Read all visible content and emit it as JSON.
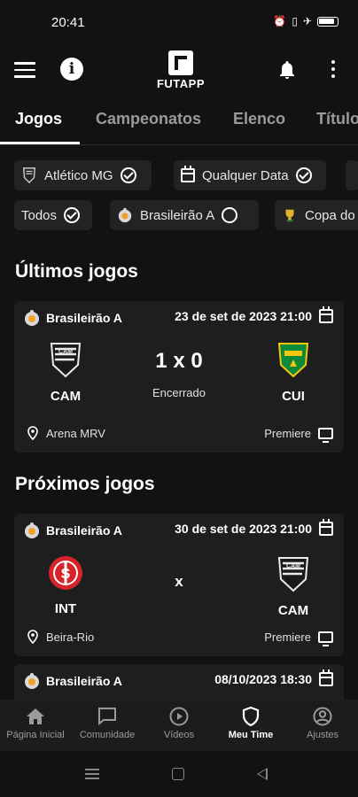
{
  "status_bar": {
    "time": "20:41"
  },
  "app": {
    "logo_text": "FUTAPP"
  },
  "tabs": [
    {
      "label": "Jogos",
      "active": true
    },
    {
      "label": "Campeonatos",
      "active": false
    },
    {
      "label": "Elenco",
      "active": false
    },
    {
      "label": "Títulos",
      "active": false
    }
  ],
  "filters": {
    "row1": [
      {
        "label": "Atlético MG",
        "icon": "team-crest-icon",
        "checked": true
      },
      {
        "label": "Qualquer Data",
        "icon": "calendar-icon",
        "checked": true
      }
    ],
    "row2": [
      {
        "label": "Todos",
        "checked": true
      },
      {
        "label": "Brasileirão A",
        "icon": "competition-icon",
        "checked": false
      },
      {
        "label": "Copa do Brasil",
        "icon": "cup-icon"
      }
    ]
  },
  "sections": {
    "last_games_title": "Últimos jogos",
    "next_games_title": "Próximos jogos"
  },
  "last_games": [
    {
      "competition": "Brasileirão A",
      "datetime": "23 de set de 2023 21:00",
      "home": "CAM",
      "away": "CUI",
      "score": "1 x 0",
      "status": "Encerrado",
      "venue": "Arena MRV",
      "broadcaster": "Premiere"
    }
  ],
  "next_games": [
    {
      "competition": "Brasileirão A",
      "datetime": "30 de set de 2023 21:00",
      "home": "INT",
      "away": "CAM",
      "versus": "x",
      "venue": "Beira-Rio",
      "broadcaster": "Premiere"
    },
    {
      "competition": "Brasileirão A",
      "datetime": "08/10/2023 18:30"
    }
  ],
  "bottom_nav": [
    {
      "label": "Página Inicial",
      "icon": "home-icon",
      "active": false
    },
    {
      "label": "Comunidade",
      "icon": "chat-icon",
      "active": false
    },
    {
      "label": "Vídeos",
      "icon": "play-icon",
      "active": false
    },
    {
      "label": "Meu Time",
      "icon": "shield-icon",
      "active": true
    },
    {
      "label": "Ajustes",
      "icon": "user-settings-icon",
      "active": false
    }
  ],
  "colors": {
    "background": "#121212",
    "card": "#1e1e1e",
    "chip": "#232323",
    "inter_red": "#d8232a",
    "cuiaba_green": "#0a8a3a",
    "cuiaba_yellow": "#f4c70d"
  }
}
